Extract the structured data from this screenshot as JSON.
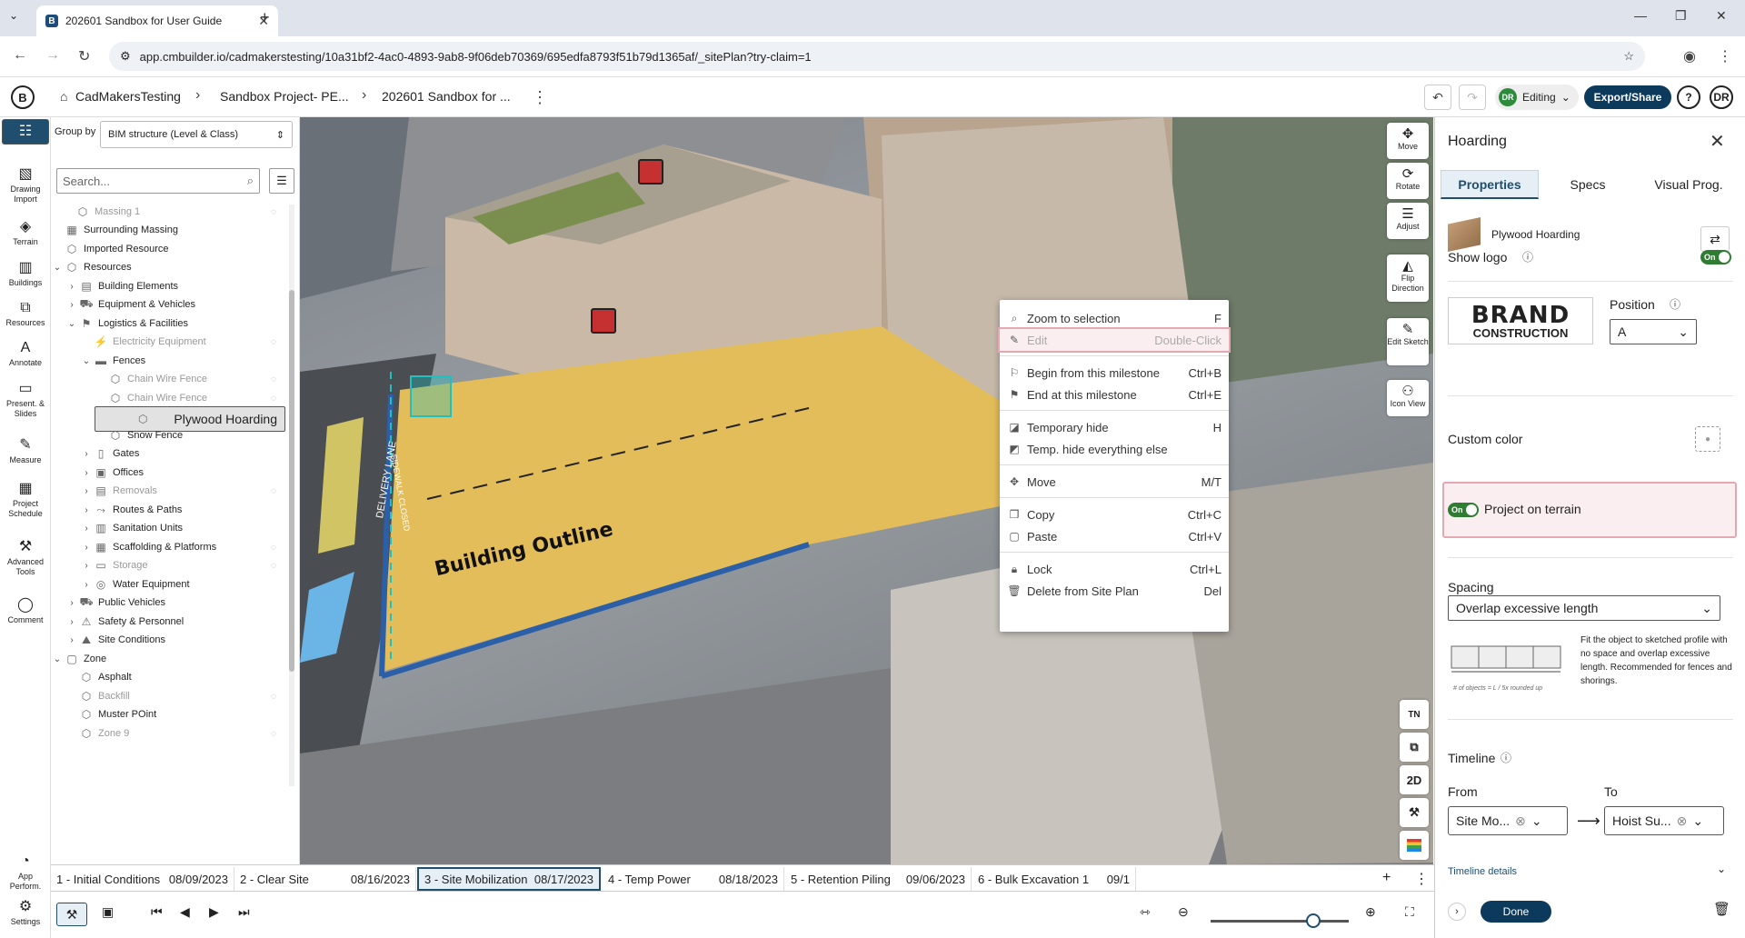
{
  "browser": {
    "tab_title": "202601 Sandbox for User Guide",
    "url": "app.cmbuilder.io/cadmakerstesting/10a31bf2-4ac0-4893-9ab8-9f06deb70369/695edfa8793f51b79d1365af/_sitePlan?try-claim=1"
  },
  "header": {
    "breadcrumbs": [
      "CadMakersTesting",
      "Sandbox Project- PE...",
      "202601 Sandbox for ..."
    ],
    "mode_initials": "DR",
    "mode_label": "Editing",
    "export_label": "Export/Share",
    "help_label": "?",
    "user_initials": "DR"
  },
  "rail": {
    "items": [
      {
        "label": "Tree",
        "icon": "tree-icon"
      },
      {
        "label": "Drawing Import",
        "icon": "drawing-import-icon"
      },
      {
        "label": "Terrain",
        "icon": "terrain-icon"
      },
      {
        "label": "Buildings",
        "icon": "buildings-icon"
      },
      {
        "label": "Resources",
        "icon": "resources-icon"
      },
      {
        "label": "Annotate",
        "icon": "annotate-icon"
      },
      {
        "label": "Present. & Slides",
        "icon": "presentation-icon"
      },
      {
        "label": "Measure",
        "icon": "measure-icon"
      },
      {
        "label": "Project Schedule",
        "icon": "schedule-icon"
      },
      {
        "label": "Advanced Tools",
        "icon": "tools-icon"
      },
      {
        "label": "Comment",
        "icon": "comment-icon"
      },
      {
        "label": "App Perform.",
        "icon": "performance-icon"
      },
      {
        "label": "Settings",
        "icon": "settings-icon"
      }
    ]
  },
  "tree": {
    "group_by_label": "Group by",
    "group_by_value": "BIM structure (Level & Class)",
    "search_placeholder": "Search...",
    "rows": [
      {
        "label": "Massing 1",
        "dim": true
      },
      {
        "label": "Surrounding Massing",
        "dim": false
      },
      {
        "label": "Imported Resource",
        "dim": false
      },
      {
        "label": "Resources",
        "dim": false
      },
      {
        "label": "Building Elements",
        "dim": false
      },
      {
        "label": "Equipment & Vehicles",
        "dim": false
      },
      {
        "label": "Logistics & Facilities",
        "dim": false
      },
      {
        "label": "Electricity Equipment",
        "dim": true
      },
      {
        "label": "Fences",
        "dim": false
      },
      {
        "label": "Chain Wire Fence",
        "dim": true
      },
      {
        "label": "Chain Wire Fence",
        "dim": true
      },
      {
        "label": "Plywood Hoarding",
        "dim": false
      },
      {
        "label": "Snow Fence",
        "dim": false
      },
      {
        "label": "Gates",
        "dim": false
      },
      {
        "label": "Offices",
        "dim": false
      },
      {
        "label": "Removals",
        "dim": true
      },
      {
        "label": "Routes & Paths",
        "dim": false
      },
      {
        "label": "Sanitation Units",
        "dim": false
      },
      {
        "label": "Scaffolding & Platforms",
        "dim": false
      },
      {
        "label": "Storage",
        "dim": true
      },
      {
        "label": "Water Equipment",
        "dim": false
      },
      {
        "label": "Public Vehicles",
        "dim": false
      },
      {
        "label": "Safety & Personnel",
        "dim": false
      },
      {
        "label": "Site Conditions",
        "dim": false
      },
      {
        "label": "Zone",
        "dim": false
      },
      {
        "label": "Asphalt",
        "dim": false
      },
      {
        "label": "Backfill",
        "dim": true
      },
      {
        "label": "Muster POint",
        "dim": false
      },
      {
        "label": "Zone 9",
        "dim": true
      }
    ]
  },
  "viewport": {
    "ground_label": "Building Outline",
    "sign_text": "SIDEWALK CLOSED",
    "lane_text": "DELIVERY LANE",
    "tools": [
      {
        "label": "Move",
        "icon": "move-icon"
      },
      {
        "label": "Rotate",
        "icon": "rotate-icon"
      },
      {
        "label": "Adjust",
        "icon": "adjust-icon"
      },
      {
        "label": "Flip Direction",
        "icon": "flip-icon"
      },
      {
        "label": "Edit Sketch",
        "icon": "edit-sketch-icon"
      },
      {
        "label": "Icon View",
        "icon": "icon-view-icon"
      }
    ],
    "view_buttons": {
      "north": "TN",
      "mode_2d": "2D"
    }
  },
  "context_menu": {
    "items": [
      {
        "label": "Zoom to selection",
        "shortcut": "F",
        "icon": "zoom-selection-icon"
      },
      {
        "label": "Edit",
        "shortcut": "Double-Click",
        "icon": "pencil-icon"
      },
      {
        "label": "Begin from this milestone",
        "shortcut": "Ctrl+B",
        "icon": "flag-icon"
      },
      {
        "label": "End at this milestone",
        "shortcut": "Ctrl+E",
        "icon": "flag-end-icon"
      },
      {
        "label": "Temporary hide",
        "shortcut": "H",
        "icon": "hide-icon"
      },
      {
        "label": "Temp. hide everything else",
        "shortcut": "",
        "icon": "hide-others-icon"
      },
      {
        "label": "Move",
        "shortcut": "M/T",
        "icon": "move-icon"
      },
      {
        "label": "Copy",
        "shortcut": "Ctrl+C",
        "icon": "copy-icon"
      },
      {
        "label": "Paste",
        "shortcut": "Ctrl+V",
        "icon": "paste-icon"
      },
      {
        "label": "Lock",
        "shortcut": "Ctrl+L",
        "icon": "lock-icon"
      },
      {
        "label": "Delete from Site Plan",
        "shortcut": "Del",
        "icon": "trash-icon"
      }
    ]
  },
  "properties": {
    "title": "Hoarding",
    "tabs": [
      "Properties",
      "Specs",
      "Visual Prog."
    ],
    "object_name": "Plywood Hoarding",
    "show_logo_label": "Show logo",
    "show_logo_state": "On",
    "position_label": "Position",
    "position_value": "A",
    "brand_line1": "BRAND",
    "brand_line2": "CONSTRUCTION",
    "custom_color_label": "Custom color",
    "project_on_terrain_label": "Project on terrain",
    "project_on_terrain_state": "On",
    "spacing_label": "Spacing",
    "spacing_value": "Overlap excessive length",
    "spacing_description": "Fit the object to sketched profile with no space and overlap excessive length. Recommended for fences and shorings.",
    "spacing_formula": "# of objects = L / 5x rounded up",
    "timeline_label": "Timeline",
    "from_label": "From",
    "to_label": "To",
    "from_value": "Site Mo...",
    "to_value": "Hoist Su...",
    "timeline_details_label": "Timeline details",
    "done_label": "Done"
  },
  "timeline": {
    "milestones": [
      {
        "name": "1 - Initial Conditions",
        "date": "08/09/2023"
      },
      {
        "name": "2 - Clear Site",
        "date": "08/16/2023"
      },
      {
        "name": "3 - Site Mobilization",
        "date": "08/17/2023"
      },
      {
        "name": "4 - Temp Power",
        "date": "08/18/2023"
      },
      {
        "name": "5 - Retention Piling",
        "date": "09/06/2023"
      },
      {
        "name": "6 - Bulk Excavation 1",
        "date": "09/1"
      }
    ]
  },
  "colors": {
    "accent": "#1f4e6e",
    "brand_dark": "#0b3a5d",
    "toggle_on": "#2e7d32",
    "highlight": "#e3a8b0"
  }
}
